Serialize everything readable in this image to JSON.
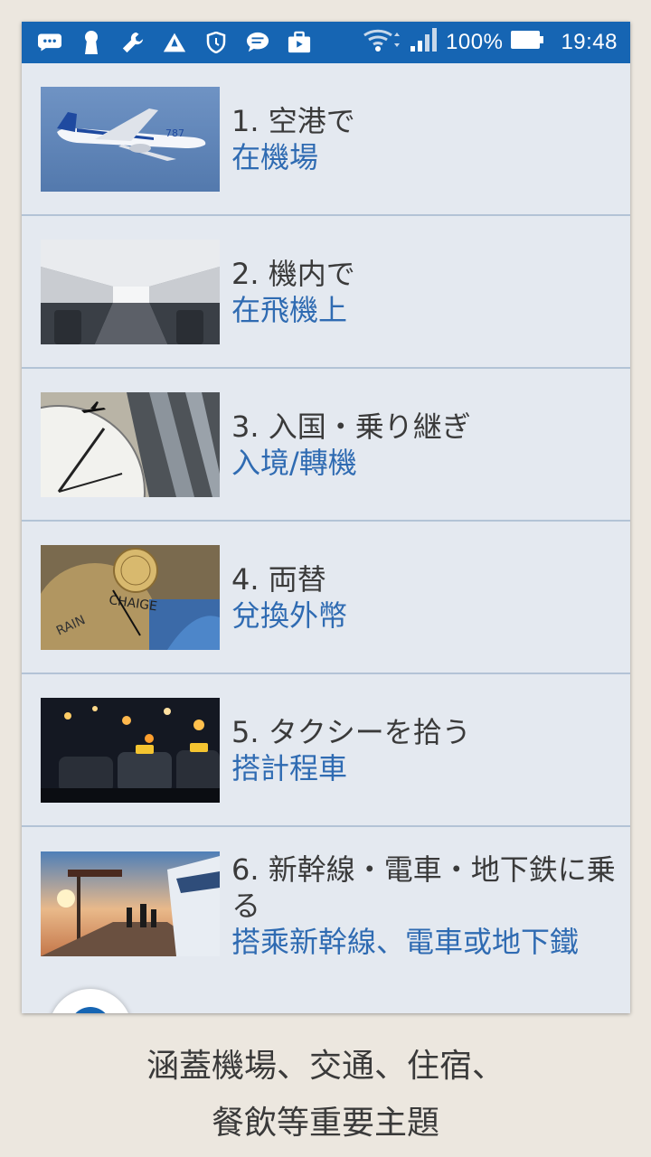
{
  "status_bar": {
    "battery": "100%",
    "time": "19:48",
    "icons": [
      "more-icon",
      "keyhole-icon",
      "wrench-icon",
      "warning-icon",
      "shield-icon",
      "message-icon",
      "briefcase-icon"
    ]
  },
  "items": [
    {
      "title": "1. 空港で",
      "subtitle": "在機場",
      "image": "airplane-photo"
    },
    {
      "title": "2. 機内で",
      "subtitle": "在飛機上",
      "image": "cabin-photo"
    },
    {
      "title": "3. 入国・乗り継ぎ",
      "subtitle": "入境/轉機",
      "image": "clock-plane-photo"
    },
    {
      "title": "4. 両替",
      "subtitle": "兌換外幣",
      "image": "currency-photo"
    },
    {
      "title": "5. タクシーを拾う",
      "subtitle": "搭計程車",
      "image": "taxi-photo"
    },
    {
      "title": "6. 新幹線・電車・地下鉄に乗る",
      "subtitle": "搭乘新幹線、電車或地下鐵",
      "image": "train-photo"
    }
  ],
  "caption": {
    "line1": "涵蓋機場、交通、住宿、",
    "line2": "餐飲等重要主題"
  }
}
